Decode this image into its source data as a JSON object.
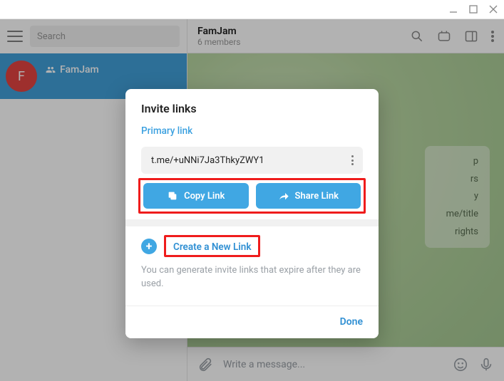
{
  "window": {
    "minimize": "–",
    "maximize": "▢",
    "close": "✕"
  },
  "sidebar": {
    "search_placeholder": "Search",
    "chat": {
      "avatar_letter": "F",
      "name": "FamJam"
    }
  },
  "header": {
    "title": "FamJam",
    "subtitle": "6 members"
  },
  "permissions": {
    "items": [
      "p",
      "rs",
      "y",
      "me/title",
      "rights"
    ]
  },
  "composer": {
    "placeholder": "Write a message..."
  },
  "dialog": {
    "title": "Invite links",
    "section": "Primary link",
    "link": "t.me/+uNNi7Ja3ThkyZWY1",
    "copy": "Copy Link",
    "share": "Share Link",
    "create": "Create a New Link",
    "help": "You can generate invite links that expire after they are used.",
    "done": "Done"
  }
}
